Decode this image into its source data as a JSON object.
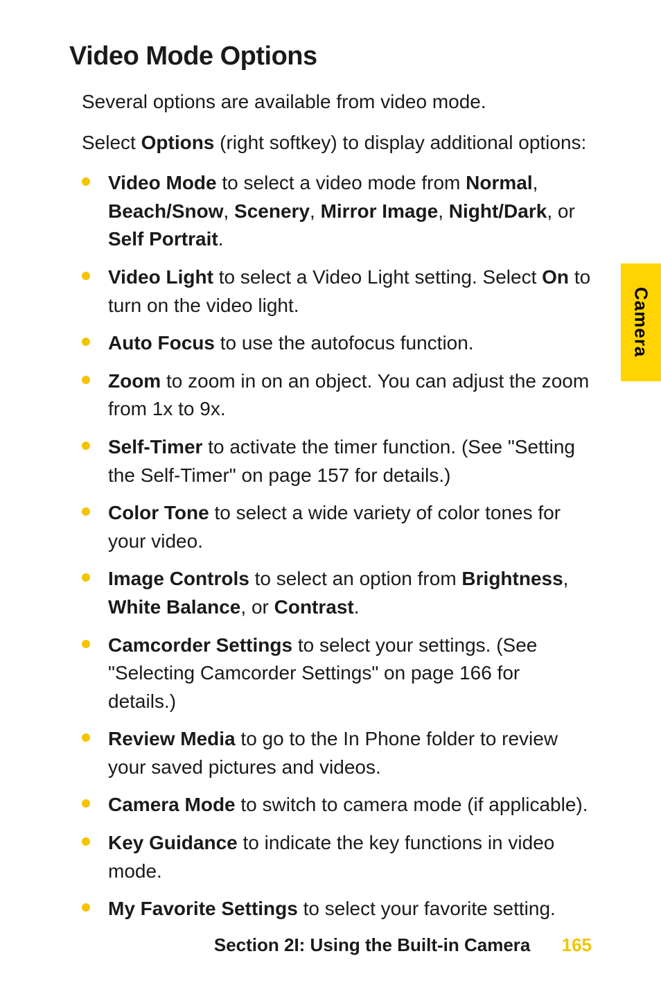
{
  "heading": "Video Mode Options",
  "intro1": "Several options are available from video mode.",
  "intro2_pre": "Select ",
  "intro2_bold": "Options",
  "intro2_post": " (right softkey) to display additional options:",
  "items": {
    "i0": {
      "b0": "Video Mode",
      "t0": " to select a video mode from ",
      "b1": "Normal",
      "t1": ", ",
      "b2": "Beach/Snow",
      "t2": ", ",
      "b3": "Scenery",
      "t3": ", ",
      "b4": "Mirror Image",
      "t4": ", ",
      "b5": "Night/Dark",
      "t5": ", or ",
      "b6": "Self Portrait",
      "t6": "."
    },
    "i1": {
      "b0": "Video Light",
      "t0": " to select a Video Light setting. Select ",
      "b1": "On",
      "t1": " to turn on the video light."
    },
    "i2": {
      "b0": "Auto Focus",
      "t0": " to use the autofocus function."
    },
    "i3": {
      "b0": "Zoom",
      "t0": " to zoom in on an object. You can adjust the zoom from 1x to 9x."
    },
    "i4": {
      "b0": "Self-Timer",
      "t0": " to activate the timer function. (See \"Setting the Self-Timer\" on page 157 for details.)"
    },
    "i5": {
      "b0": "Color Tone",
      "t0": " to select a wide variety of color tones for your video."
    },
    "i6": {
      "b0": "Image Controls",
      "t0": " to select an option from ",
      "b1": "Brightness",
      "t1": ", ",
      "b2": "White Balance",
      "t2": ", or ",
      "b3": "Contrast",
      "t3": "."
    },
    "i7": {
      "b0": "Camcorder Settings",
      "t0": " to select your settings. (See \"Selecting Camcorder Settings\" on page 166 for details.)"
    },
    "i8": {
      "b0": "Review Media",
      "t0": " to go to the In Phone folder to review your saved pictures and videos."
    },
    "i9": {
      "b0": "Camera Mode",
      "t0": " to switch to camera mode (if applicable)."
    },
    "i10": {
      "b0": "Key Guidance",
      "t0": " to indicate the key functions in video mode."
    },
    "i11": {
      "b0": "My Favorite Settings",
      "t0": " to select your favorite setting."
    }
  },
  "side_tab": "Camera",
  "footer_section": "Section 2I: Using the Built-in Camera",
  "footer_page": "165"
}
